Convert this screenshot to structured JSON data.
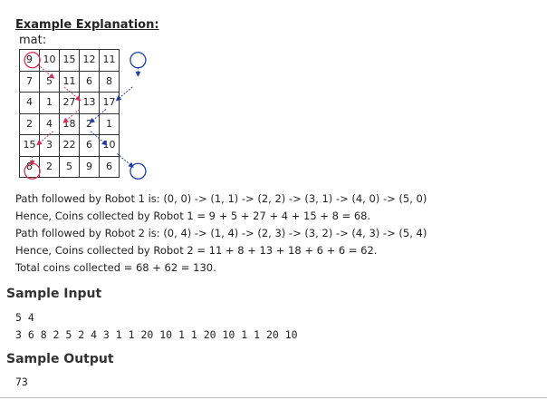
{
  "explanation_title": "Example Explanation:",
  "mat_label": "mat:",
  "matrix": [
    [
      "9",
      "10",
      "15",
      "12",
      "11"
    ],
    [
      "7",
      "5",
      "11",
      "6",
      "8"
    ],
    [
      "4",
      "1",
      "27",
      "13",
      "17"
    ],
    [
      "2",
      "4",
      "18",
      "2",
      "1"
    ],
    [
      "15",
      "3",
      "22",
      "6",
      "10"
    ],
    [
      "8",
      "2",
      "5",
      "9",
      "6"
    ]
  ],
  "colors": {
    "robot1": "#d22f55",
    "robot2": "#1f3fa8"
  },
  "explanation_lines": [
    "Path followed by Robot 1 is: (0, 0) -> (1, 1) -> (2, 2) -> (3, 1) -> (4, 0) -> (5, 0)",
    "Hence, Coins collected by Robot 1 = 9 + 5 + 27 + 4 + 15 + 8 = 68.",
    "Path followed by Robot 2 is: (0, 4) -> (1, 4) -> (2, 3) -> (3, 2) -> (4, 3) -> (5, 4)",
    "Hence, Coins collected by Robot 2 = 11 + 8 + 13 + 18 + 6 + 6 = 62.",
    "Total coins collected = 68 + 62 = 130."
  ],
  "sample_input_title": "Sample Input",
  "sample_input_lines": [
    "5 4",
    "3 6 8 2 5 2 4 3 1 1 20 10 1 1 20 10 1 1 20 10"
  ],
  "sample_output_title": "Sample Output",
  "sample_output_lines": [
    "73"
  ]
}
